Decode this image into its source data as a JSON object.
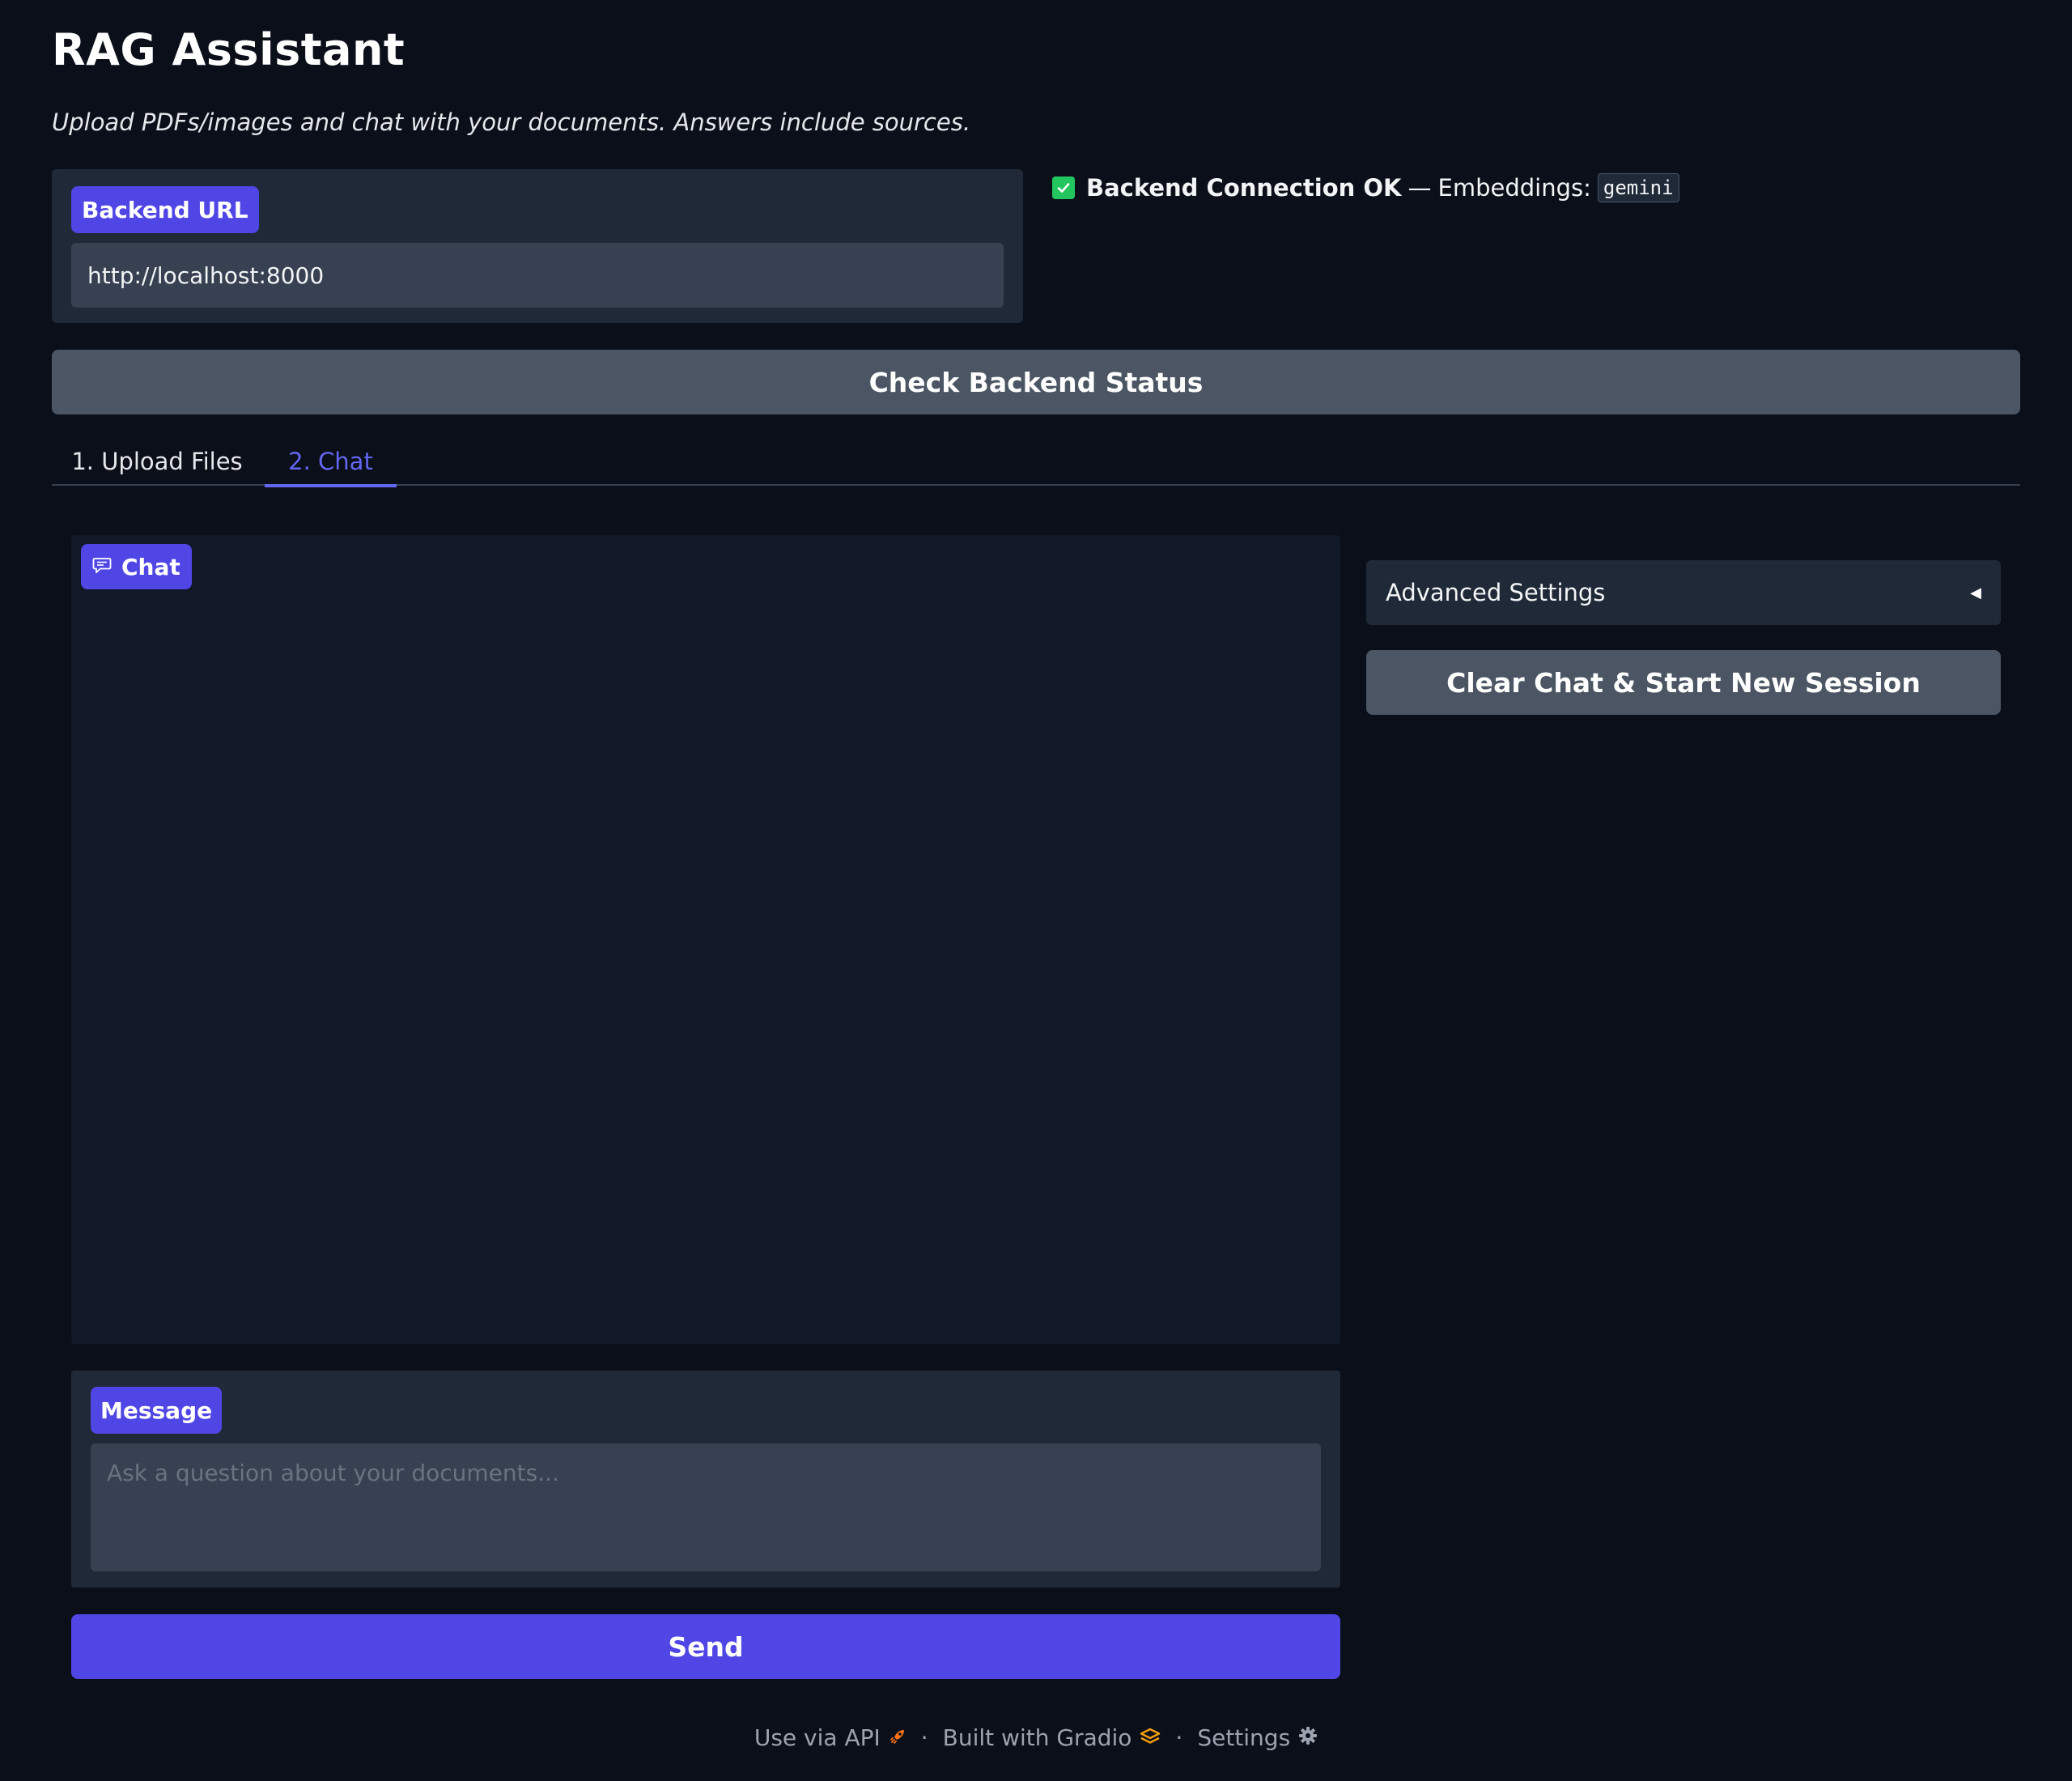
{
  "header": {
    "title": "RAG Assistant",
    "subtitle": "Upload PDFs/images and chat with your documents. Answers include sources."
  },
  "backend": {
    "label": "Backend URL",
    "url_value": "http://localhost:8000",
    "status_bold": "Backend Connection OK",
    "status_dash": "—",
    "status_text": "Embeddings:",
    "embeddings_model": "gemini",
    "check_button": "Check Backend Status"
  },
  "tabs": [
    {
      "label": "1. Upload Files",
      "active": false
    },
    {
      "label": "2. Chat",
      "active": true
    }
  ],
  "chat": {
    "label": "Chat"
  },
  "message": {
    "label": "Message",
    "placeholder": "Ask a question about your documents...",
    "value": "",
    "send_button": "Send"
  },
  "sidebar": {
    "advanced_settings": "Advanced Settings",
    "clear_button": "Clear Chat & Start New Session"
  },
  "footer": {
    "api": "Use via API",
    "gradio": "Built with Gradio",
    "settings": "Settings",
    "separator": "·"
  },
  "colors": {
    "background": "#0b0f19",
    "panel": "#1f2937",
    "accent": "#4f46e5",
    "tab_active": "#6366f1",
    "success": "#22c55e"
  }
}
